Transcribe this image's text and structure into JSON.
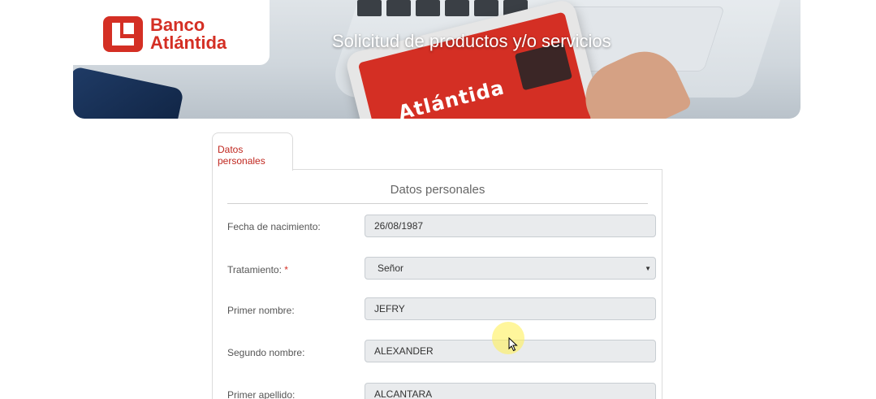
{
  "header": {
    "logo_text_line1": "Banco",
    "logo_text_line2": "Atlántida",
    "title": "Solicitud de productos y/o servicios",
    "tablet_screen_text": "Atlántida"
  },
  "colors": {
    "brand_red": "#d42f24",
    "field_bg": "#e9ebed",
    "border": "#dcdcdc"
  },
  "tabs": [
    {
      "label": "Datos personales",
      "active": true
    }
  ],
  "form": {
    "section_title": "Datos personales",
    "fields": [
      {
        "label": "Fecha de nacimiento:",
        "value": "26/08/1987",
        "type": "text"
      },
      {
        "label": "Tratamiento:",
        "required_mark": "*",
        "value": "Señor",
        "type": "select"
      },
      {
        "label": "Primer nombre:",
        "value": "JEFRY",
        "type": "text"
      },
      {
        "label": "Segundo nombre:",
        "value": "ALEXANDER",
        "type": "text"
      },
      {
        "label": "Primer apellido:",
        "value": "ALCANTARA",
        "type": "text"
      }
    ]
  },
  "icons": {
    "logo": "banco-atlantida-logo-icon",
    "select_arrow": "chevron-down-icon",
    "cursor": "mouse-pointer-icon"
  }
}
